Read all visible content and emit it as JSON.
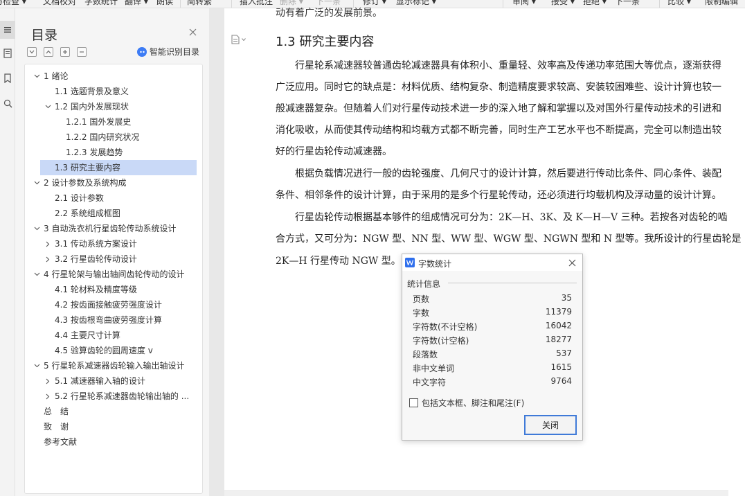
{
  "ribbon": {
    "items": [
      {
        "label": "与检查 ▾",
        "disabled": false
      },
      {
        "label": "文档校对",
        "disabled": false
      },
      {
        "label": "字数统计",
        "disabled": false
      },
      {
        "label": "翻译 ▾",
        "disabled": false
      },
      {
        "label": "朗读",
        "disabled": false
      },
      {
        "label": "简转繁",
        "disabled": false
      },
      {
        "label": "插入批注",
        "disabled": false
      },
      {
        "label": "删除 ▾",
        "disabled": true
      },
      {
        "label": "下一条",
        "disabled": true
      },
      {
        "label": "修订 ▾",
        "disabled": false
      },
      {
        "label": "显示标记 ▾",
        "disabled": false
      },
      {
        "label": "审阅 ▾",
        "disabled": false
      },
      {
        "label": "接受 ▾",
        "disabled": false
      },
      {
        "label": "拒绝 ▾",
        "disabled": false
      },
      {
        "label": "下一条",
        "disabled": false
      },
      {
        "label": "比较 ▾",
        "disabled": false
      },
      {
        "label": "限制编辑",
        "disabled": false
      }
    ]
  },
  "side_strip": {
    "icons": [
      "toc-icon",
      "pages-icon",
      "bookmark-icon",
      "find-icon"
    ]
  },
  "toc": {
    "title": "目录",
    "smart_label": "智能识别目录",
    "items": [
      {
        "label": "1 绪论",
        "level": 1,
        "arrow": "down",
        "selected": false
      },
      {
        "label": "1.1 选题背景及意义",
        "level": 2,
        "arrow": "",
        "selected": false
      },
      {
        "label": "1.2 国内外发展现状",
        "level": 2,
        "arrow": "down",
        "selected": false
      },
      {
        "label": "1.2.1 国外发展史",
        "level": 3,
        "arrow": "",
        "selected": false
      },
      {
        "label": "1.2.2 国内研究状况",
        "level": 3,
        "arrow": "",
        "selected": false
      },
      {
        "label": "1.2.3 发展趋势",
        "level": 3,
        "arrow": "",
        "selected": false
      },
      {
        "label": "1.3 研究主要内容",
        "level": 2,
        "arrow": "",
        "selected": true
      },
      {
        "label": "2 设计参数及系统构成",
        "level": 1,
        "arrow": "down",
        "selected": false
      },
      {
        "label": "2.1 设计参数",
        "level": 2,
        "arrow": "",
        "selected": false
      },
      {
        "label": "2.2 系统组成框图",
        "level": 2,
        "arrow": "",
        "selected": false
      },
      {
        "label": "3 自动洗衣机行星齿轮传动系统设计",
        "level": 1,
        "arrow": "down",
        "selected": false
      },
      {
        "label": "3.1 传动系统方案设计",
        "level": 2,
        "arrow": "right",
        "selected": false
      },
      {
        "label": "3.2 行星齿轮传动设计",
        "level": 2,
        "arrow": "right",
        "selected": false
      },
      {
        "label": "4 行星轮架与输出轴间齿轮传动的设计",
        "level": 1,
        "arrow": "down",
        "selected": false
      },
      {
        "label": "4.1 轮材料及精度等级",
        "level": 2,
        "arrow": "",
        "selected": false
      },
      {
        "label": "4.2 按齿面接触疲劳强度设计",
        "level": 2,
        "arrow": "",
        "selected": false
      },
      {
        "label": "4.3 按齿根弯曲疲劳强度计算",
        "level": 2,
        "arrow": "",
        "selected": false
      },
      {
        "label": "4.4 主要尺寸计算",
        "level": 2,
        "arrow": "",
        "selected": false
      },
      {
        "label": "4.5 验算齿轮的圆周速度 v",
        "level": 2,
        "arrow": "",
        "selected": false
      },
      {
        "label": "5 行星轮系减速器齿轮输入输出轴设计",
        "level": 1,
        "arrow": "down",
        "selected": false
      },
      {
        "label": "5.1 减速器输入轴的设计",
        "level": 2,
        "arrow": "right",
        "selected": false
      },
      {
        "label": "5.2 行星轮系减速器齿轮输出轴的 ...",
        "level": 2,
        "arrow": "right",
        "selected": false
      },
      {
        "label": "总　结",
        "level": 0,
        "arrow": "",
        "selected": false
      },
      {
        "label": "致　谢",
        "level": 0,
        "arrow": "",
        "selected": false
      },
      {
        "label": "参考文献",
        "level": 0,
        "arrow": "",
        "selected": false
      }
    ]
  },
  "document": {
    "top_fragment": "动有着广泛的发展前景。",
    "heading": "1.3 研究主要内容",
    "lines": [
      {
        "text": "　　行星轮系减速器较普通齿轮减速器具有体积小、重量轻、效率高及传递功率范围大等优点，逐渐获得",
        "justify": true
      },
      {
        "text": "广泛应用。同时它的缺点是：材料优质、结构复杂、制造精度要求较高、安装较困难些、设计计算也较一",
        "justify": true
      },
      {
        "text": "般减速器复杂。但随着人们对行星传动技术进一步的深入地了解和掌握以及对国外行星传动技术的引进和",
        "justify": true
      },
      {
        "text": "消化吸收，从而使其传动结构和均载方式都不断完善，同时生产工艺水平也不断提高，完全可以制造出较",
        "justify": true
      },
      {
        "text": "好的行星齿轮传动减速器。",
        "justify": false
      },
      {
        "text": "　　根据负载情况进行一般的齿轮强度、几何尺寸的设计计算，然后要进行传动比条件、同心条件、装配",
        "justify": true
      },
      {
        "text": "条件、相邻条件的设计计算，由于采用的是多个行星轮传动，还必须进行均载机构及浮动量的设计计算。",
        "justify": true
      },
      {
        "text": "　　行星齿轮传动根据基本够件的组成情况可分为：2K—H、3K、及 K—H—V 三种。若按各对齿轮的啮",
        "justify": true
      },
      {
        "text": "合方式，又可分为：NGW 型、NN 型、WW 型、WGW 型、NGWN 型和 N 型等。我所设计的行星齿轮是",
        "justify": true
      },
      {
        "text": "2K—H 行星传动 NGW 型。",
        "justify": false
      }
    ]
  },
  "dialog": {
    "title": "字数统计",
    "group_label": "统计信息",
    "stats": [
      {
        "label": "页数",
        "value": "35"
      },
      {
        "label": "字数",
        "value": "11379"
      },
      {
        "label": "字符数(不计空格)",
        "value": "16042"
      },
      {
        "label": "字符数(计空格)",
        "value": "18277"
      },
      {
        "label": "段落数",
        "value": "537"
      },
      {
        "label": "非中文单词",
        "value": "1615"
      },
      {
        "label": "中文字符",
        "value": "9764"
      }
    ],
    "checkbox_label": "包括文本框、脚注和尾注(F)",
    "checkbox_checked": false,
    "close_button": "关闭"
  },
  "colors": {
    "accent": "#3d7cf5",
    "toc_selected": "#c9d9f7",
    "button_border": "#3f7ad8"
  }
}
